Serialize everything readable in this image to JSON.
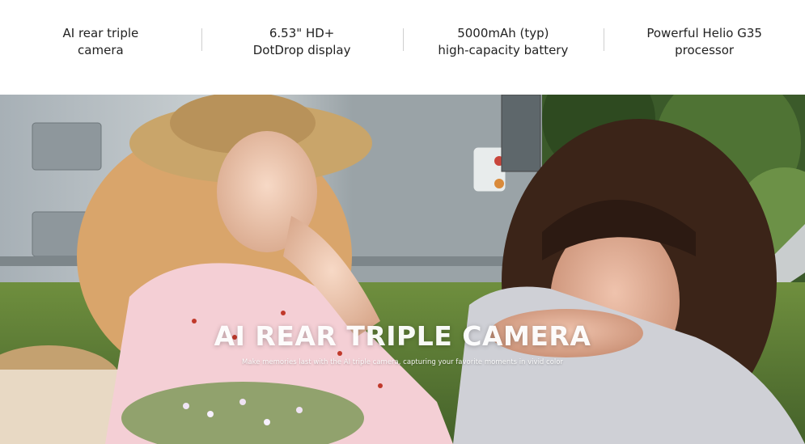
{
  "features": [
    {
      "text": "AI rear triple\ncamera"
    },
    {
      "text": "6.53\" HD+\nDotDrop display"
    },
    {
      "text": "5000mAh (typ)\nhigh-capacity battery"
    },
    {
      "text": "Powerful Helio G35\nprocessor"
    }
  ],
  "hero": {
    "title": "AI REAR TRIPLE CAMERA",
    "subtitle": "Make memories last with the AI triple camera, capturing your favorite moments in vivid color"
  },
  "colors": {
    "page_bg": "#ffffff",
    "feature_text": "#222222",
    "divider": "#cfcfcf",
    "hero_text": "#ffffff"
  }
}
